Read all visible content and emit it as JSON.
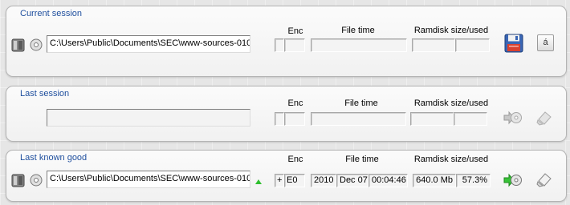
{
  "columns": {
    "enc": "Enc",
    "file_time": "File time",
    "ramdisk": "Ramdisk size/used"
  },
  "current": {
    "title": "Current session",
    "path": "C:\\Users\\Public\\Documents\\SEC\\www-sources-010",
    "enc_flag": "",
    "enc_value": "",
    "file_time": "",
    "ramdisk_size": "",
    "ramdisk_used": "",
    "action_button": "á"
  },
  "last": {
    "title": "Last session",
    "path": "",
    "enc_flag": "",
    "enc_value": "",
    "file_time": "",
    "ramdisk_size": "",
    "ramdisk_used": ""
  },
  "last_good": {
    "title": "Last known good",
    "path": "C:\\Users\\Public\\Documents\\SEC\\www-sources-010",
    "enc_flag": "+",
    "enc_value": "E0",
    "year": "2010",
    "date": "Dec 07",
    "time": "00:04:46",
    "ramdisk_size": "640.0 Mb",
    "ramdisk_used": "57.3%"
  },
  "icons": {
    "drive": "drive-icon",
    "disc": "disc-icon",
    "save": "floppy-save-icon",
    "restore": "restore-disc-icon",
    "clear": "clear-eraser-icon",
    "status": "green-up-arrow-icon"
  }
}
